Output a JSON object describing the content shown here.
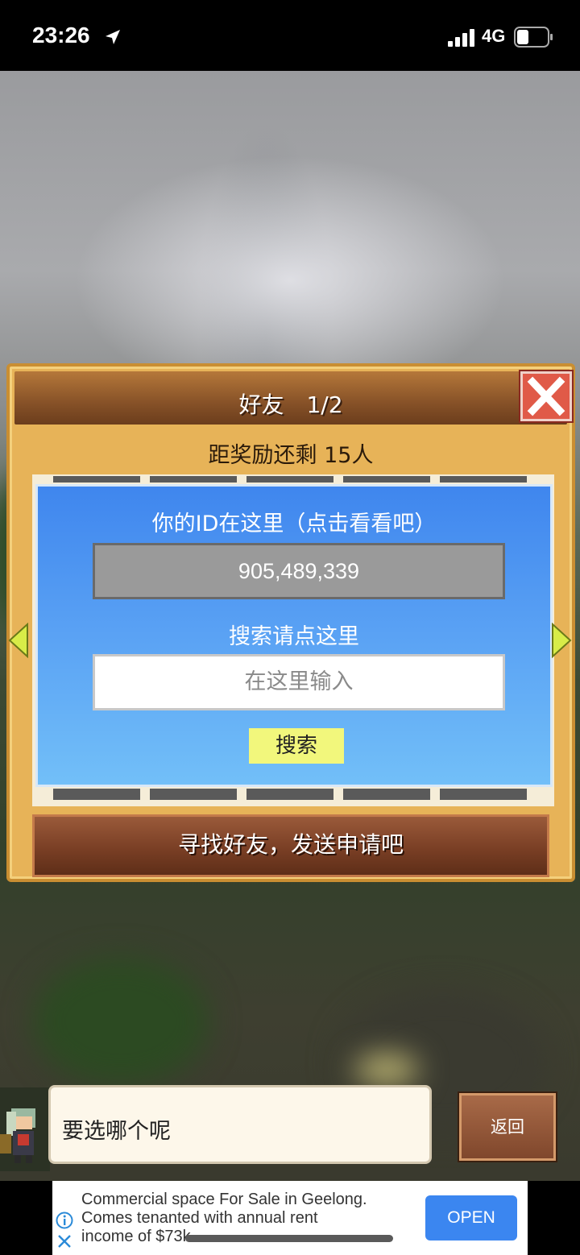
{
  "status_bar": {
    "time": "23:26",
    "network": "4G",
    "icons": [
      "location-arrow-icon",
      "signal-bars-icon",
      "battery-icon"
    ]
  },
  "dialog": {
    "title": "好友　1/2",
    "reward_text": "距奖励还剩 15人",
    "id_label": "你的ID在这里（点击看看吧）",
    "id_value": "905,489,339",
    "search_label": "搜索请点这里",
    "search_placeholder": "在这里输入",
    "search_button": "搜索",
    "find_button": "寻找好友，发送申请吧"
  },
  "bottom_bar": {
    "speech": "要选哪个呢",
    "back_button": "返回"
  },
  "ad": {
    "line1": "Commercial space For Sale in Geelong.",
    "line2": "Comes tenanted with annual rent",
    "line3": "income of $73k",
    "open_button": "OPEN"
  },
  "colors": {
    "dialog_wood": "#e7b358",
    "header_brown": "#8a5429",
    "panel_blue": "#5aa2f4",
    "close_red": "#e05a48",
    "search_yellow": "#f2f77c",
    "ad_blue": "#3b86f0"
  }
}
